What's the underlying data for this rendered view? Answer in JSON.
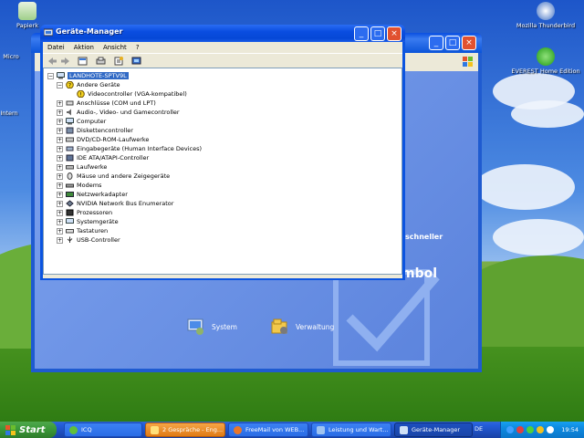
{
  "desktop": {
    "icons": [
      {
        "label": "Papierk"
      },
      {
        "label": "Micro"
      },
      {
        "label": "Intern"
      },
      {
        "label": "Mozilla Thunderbird"
      },
      {
        "label": "EVEREST Home Edition"
      }
    ]
  },
  "control_panel": {
    "text_schneller": "schneller",
    "text_mbol": "mbol",
    "link_system": "System",
    "link_verwaltung": "Verwaltung"
  },
  "device_manager": {
    "title": "Geräte-Manager",
    "menu": [
      "Datei",
      "Aktion",
      "Ansicht",
      "?"
    ],
    "tree": {
      "root": "LANDHOTE-SPTV9L",
      "items": [
        {
          "label": "Andere Geräte",
          "expanded": true
        },
        {
          "label": "Videocontroller (VGA-kompatibel)",
          "child": true
        },
        {
          "label": "Anschlüsse (COM und LPT)"
        },
        {
          "label": "Audio-, Video- und Gamecontroller"
        },
        {
          "label": "Computer"
        },
        {
          "label": "Diskettencontroller"
        },
        {
          "label": "DVD/CD-ROM-Laufwerke"
        },
        {
          "label": "Eingabegeräte (Human Interface Devices)"
        },
        {
          "label": "IDE ATA/ATAPI-Controller"
        },
        {
          "label": "Laufwerke"
        },
        {
          "label": "Mäuse und andere Zeigegeräte"
        },
        {
          "label": "Modems"
        },
        {
          "label": "Netzwerkadapter"
        },
        {
          "label": "NVIDIA Network Bus Enumerator"
        },
        {
          "label": "Prozessoren"
        },
        {
          "label": "Systemgeräte"
        },
        {
          "label": "Tastaturen"
        },
        {
          "label": "USB-Controller"
        }
      ]
    }
  },
  "taskbar": {
    "start_label": "Start",
    "buttons": [
      {
        "label": "ICQ"
      },
      {
        "label": "2 Gespräche - Eng..."
      },
      {
        "label": "FreeMail von WEB..."
      },
      {
        "label": "Leistung und Wart..."
      },
      {
        "label": "Geräte-Manager"
      }
    ],
    "language": "DE",
    "clock": "19:54"
  },
  "colors": {
    "xp_blue": "#0b54e0",
    "tree_highlight": "#316ac5",
    "start_green": "#3c9b3a",
    "orange_button": "#e07a15"
  }
}
